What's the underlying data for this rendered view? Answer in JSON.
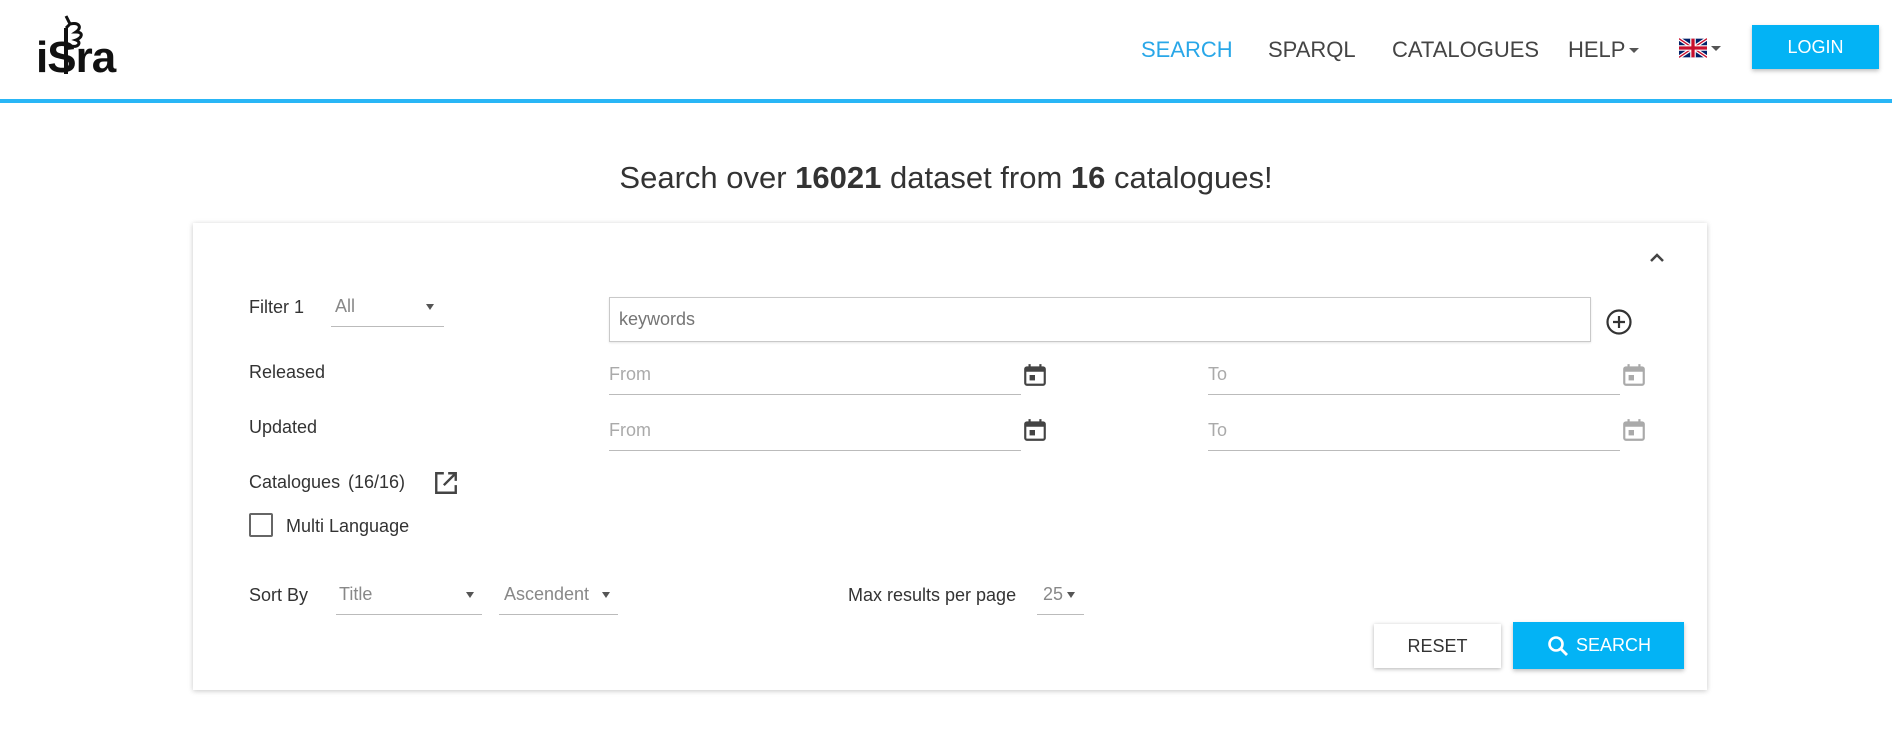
{
  "header": {
    "logo_text": "iSra",
    "nav": {
      "search": "SEARCH",
      "sparql": "SPARQL",
      "catalogues": "CATALOGUES",
      "help": "HELP"
    },
    "language_icon": "uk-flag-icon",
    "login_label": "LOGIN"
  },
  "headline": {
    "prefix": "Search over ",
    "datasets": "16021",
    "middle": " dataset from ",
    "catalogues": "16",
    "suffix": " catalogues!"
  },
  "form": {
    "filter1_label": "Filter 1",
    "filter1_value": "All",
    "keywords_placeholder": "keywords",
    "released_label": "Released",
    "updated_label": "Updated",
    "from_placeholder": "From",
    "to_placeholder": "To",
    "catalogues_label": "Catalogues",
    "catalogues_count": "(16/16)",
    "multi_language_label": "Multi Language",
    "sort_by_label": "Sort By",
    "sort_field_value": "Title",
    "sort_order_value": "Ascendent",
    "max_results_label": "Max results per page",
    "max_results_value": "25",
    "reset_label": "RESET",
    "search_label": "SEARCH"
  },
  "colors": {
    "accent": "#03b3f5",
    "nav_active": "#29a7e8"
  }
}
